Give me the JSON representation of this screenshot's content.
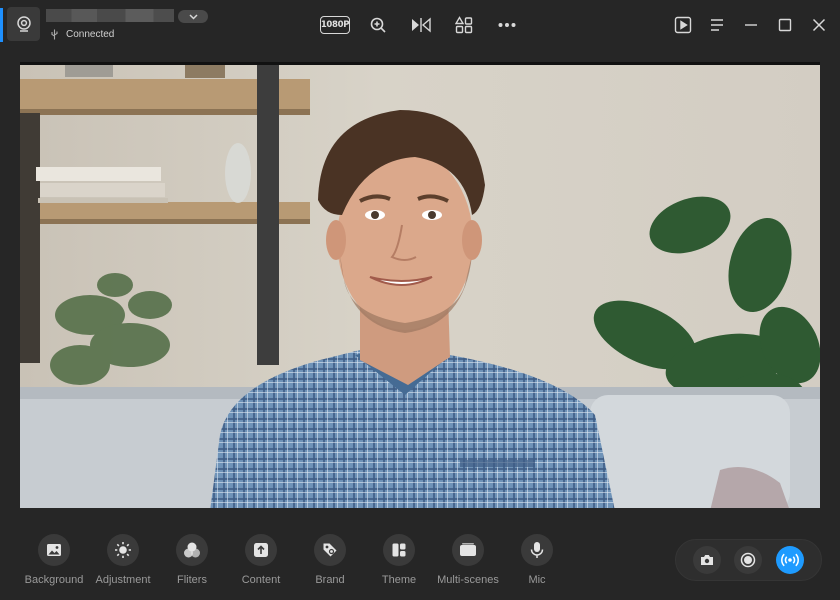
{
  "titlebar": {
    "status": "Connected",
    "resolution": "1080P"
  },
  "icons": {
    "app": "webcam-icon",
    "status": "usb-icon",
    "dropdown": "chevron-down-icon",
    "zoom": "zoom-in-icon",
    "mirror": "mirror-flip-icon",
    "widgets": "shapes-icon",
    "more": "more-dots-icon",
    "player": "play-box-icon",
    "menu": "menu-icon",
    "minimize": "minimize-icon",
    "maximize": "maximize-icon",
    "close": "close-icon"
  },
  "toolbar": {
    "items": [
      {
        "label": "Background",
        "icon": "image-icon"
      },
      {
        "label": "Adjustment",
        "icon": "brightness-icon"
      },
      {
        "label": "Fliters",
        "icon": "filters-icon"
      },
      {
        "label": "Content",
        "icon": "upload-icon"
      },
      {
        "label": "Brand",
        "icon": "tag-icon"
      },
      {
        "label": "Theme",
        "icon": "layout-icon"
      },
      {
        "label": "Multi-scenes",
        "icon": "scenes-icon"
      },
      {
        "label": "Mic",
        "icon": "mic-icon"
      }
    ]
  },
  "capture": {
    "snapshot_icon": "camera-icon",
    "record_icon": "record-icon",
    "live_icon": "broadcast-icon",
    "accent": "#1e9bff"
  },
  "colors": {
    "background": "#262626",
    "accent": "#1e90ff"
  }
}
